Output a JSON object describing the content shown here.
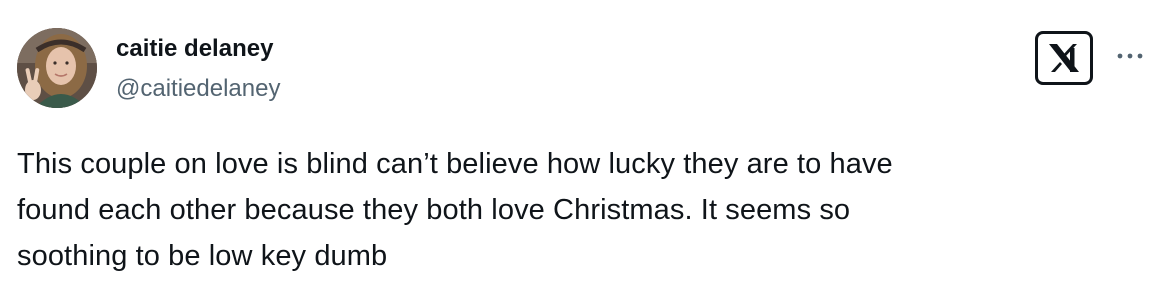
{
  "author": {
    "display_name": "caitie delaney",
    "handle": "@caitiedelaney",
    "avatar_icon": "profile-photo"
  },
  "header": {
    "platform_icon": "x-logo-icon",
    "more_icon": "more-options-icon"
  },
  "post": {
    "lines": [
      "This couple on love is blind can’t believe how lucky they are to have",
      "found each other because they both love Christmas. It seems so",
      "soothing to be low key dumb"
    ]
  },
  "colors": {
    "text_primary": "#0f1419",
    "text_secondary": "#536471",
    "background": "#ffffff"
  }
}
